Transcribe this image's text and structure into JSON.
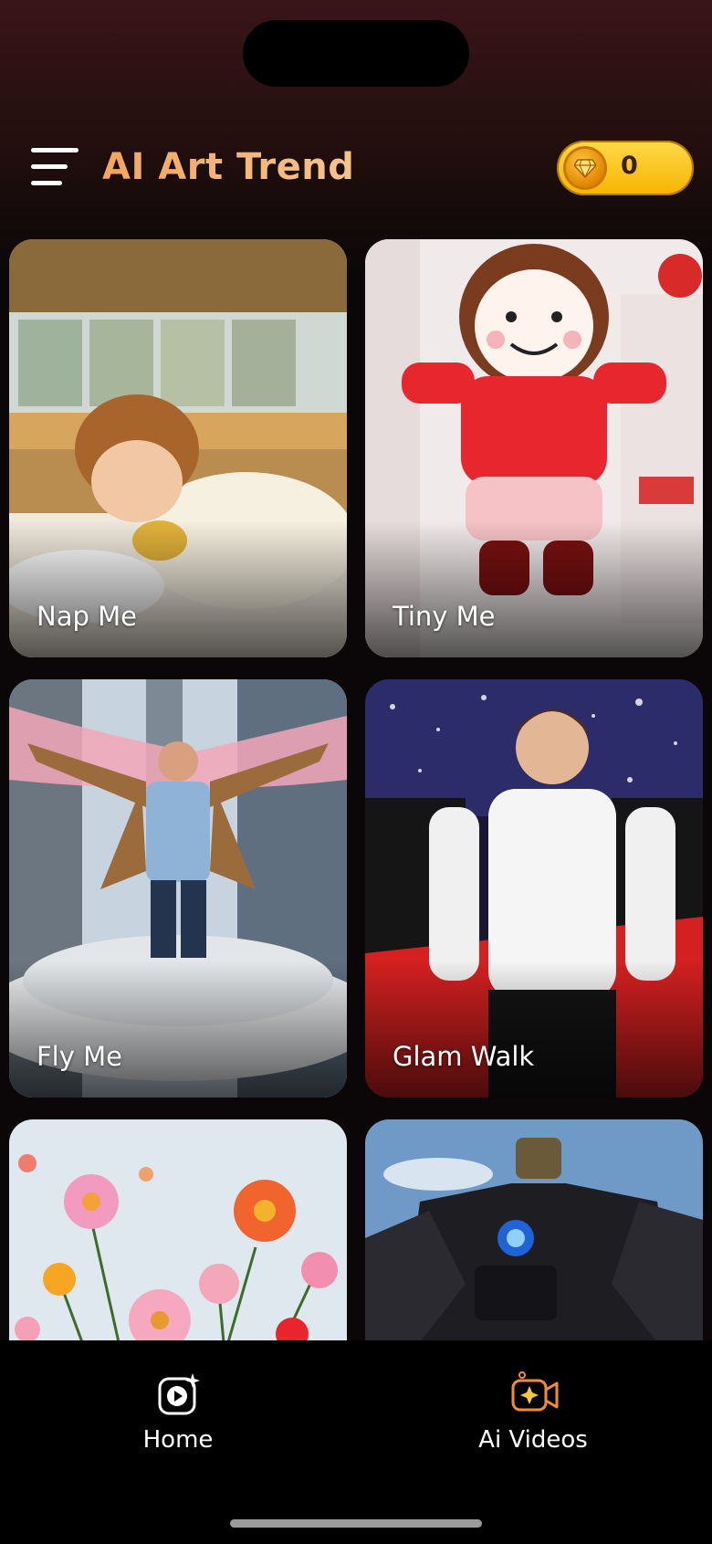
{
  "header": {
    "menu_icon": "hamburger-menu-icon",
    "title": "AI Art Trend",
    "coins": {
      "icon": "gem-coin-icon",
      "count": "0"
    }
  },
  "cards": [
    {
      "label": "Nap Me"
    },
    {
      "label": "Tiny Me"
    },
    {
      "label": "Fly Me"
    },
    {
      "label": "Glam Walk"
    },
    {
      "label": ""
    },
    {
      "label": ""
    }
  ],
  "bottom_nav": {
    "items": [
      {
        "label": "Home",
        "icon": "play-sparkle-icon"
      },
      {
        "label": "Ai Videos",
        "icon": "camera-sparkle-icon",
        "active": true
      }
    ]
  },
  "colors": {
    "title_gradient": [
      "#f2a55e",
      "#f6c58a"
    ],
    "coin_pill": "#ffd94a",
    "accent_active": "#f28c38"
  }
}
